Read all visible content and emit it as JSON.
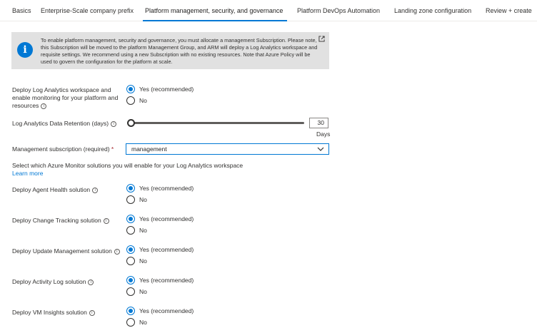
{
  "tabs": [
    {
      "label": "Basics"
    },
    {
      "label": "Enterprise-Scale company prefix"
    },
    {
      "label": "Platform management, security, and governance"
    },
    {
      "label": "Platform DevOps Automation"
    },
    {
      "label": "Landing zone configuration"
    },
    {
      "label": "Review + create"
    }
  ],
  "active_tab": "Platform management, security, and governance",
  "banner": {
    "text": "To enable platform management, security and governance, you must allocate a management Subscription. Please note, this Subscription will be moved to the platform Management Group, and ARM will deploy a Log Analytics workspace and requisite settings. We recommend using a new Subscription with no existing resources. Note that Azure Policy will be used to govern the configuration for the platform at scale."
  },
  "log_analytics": {
    "label": "Deploy Log Analytics workspace and enable monitoring for your platform and resources",
    "yes": "Yes (recommended)",
    "no": "No",
    "selected": "yes"
  },
  "retention": {
    "label": "Log Analytics Data Retention (days)",
    "value": "30",
    "unit": "Days"
  },
  "management_subscription": {
    "label": "Management subscription (required)",
    "required_marker": "*",
    "value": "management"
  },
  "solutions_intro": "Select which Azure Monitor solutions you will enable for your Log Analytics workspace",
  "learn_more": "Learn more",
  "solutions": [
    {
      "label": "Deploy Agent Health solution",
      "yes": "Yes (recommended)",
      "no": "No",
      "selected": "yes"
    },
    {
      "label": "Deploy Change Tracking solution",
      "yes": "Yes (recommended)",
      "no": "No",
      "selected": "yes"
    },
    {
      "label": "Deploy Update Management solution",
      "yes": "Yes (recommended)",
      "no": "No",
      "selected": "yes"
    },
    {
      "label": "Deploy Activity Log solution",
      "yes": "Yes (recommended)",
      "no": "No",
      "selected": "yes"
    },
    {
      "label": "Deploy VM Insights solution",
      "yes": "Yes (recommended)",
      "no": "No",
      "selected": "yes"
    }
  ],
  "colors": {
    "accent": "#0078d4",
    "banner_bg": "#e1e1e1",
    "required": "#a4262c"
  },
  "icons": {
    "banner": "info-icon",
    "external": "external-link-icon",
    "tooltip": "info-circle-icon",
    "dropdown": "chevron-down-icon"
  }
}
